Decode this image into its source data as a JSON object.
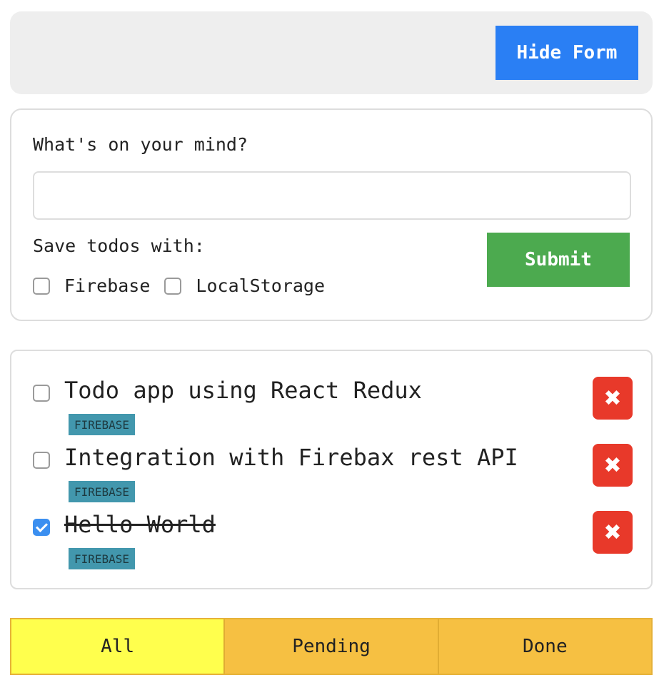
{
  "header": {
    "hide_form_label": "Hide Form"
  },
  "form": {
    "prompt": "What's on your mind?",
    "input_value": "",
    "save_label": "Save todos with:",
    "options": [
      {
        "label": "Firebase",
        "checked": false
      },
      {
        "label": "LocalStorage",
        "checked": false
      }
    ],
    "submit_label": "Submit"
  },
  "todos": [
    {
      "text": "Todo app using React Redux",
      "tag": "FIREBASE",
      "done": false,
      "delete_icon": "✖"
    },
    {
      "text": "Integration with Firebax rest API",
      "tag": "FIREBASE",
      "done": false,
      "delete_icon": "✖"
    },
    {
      "text": "Hello World",
      "tag": "FIREBASE",
      "done": true,
      "delete_icon": "✖"
    }
  ],
  "filters": [
    {
      "label": "All",
      "active": true
    },
    {
      "label": "Pending",
      "active": false
    },
    {
      "label": "Done",
      "active": false
    }
  ],
  "colors": {
    "accent_blue": "#2a7ff4",
    "submit_green": "#4caa4f",
    "delete_red": "#e8392a",
    "tag_teal": "#4297ad",
    "filter_active": "#ffff4d",
    "filter_inactive": "#f6c042"
  }
}
